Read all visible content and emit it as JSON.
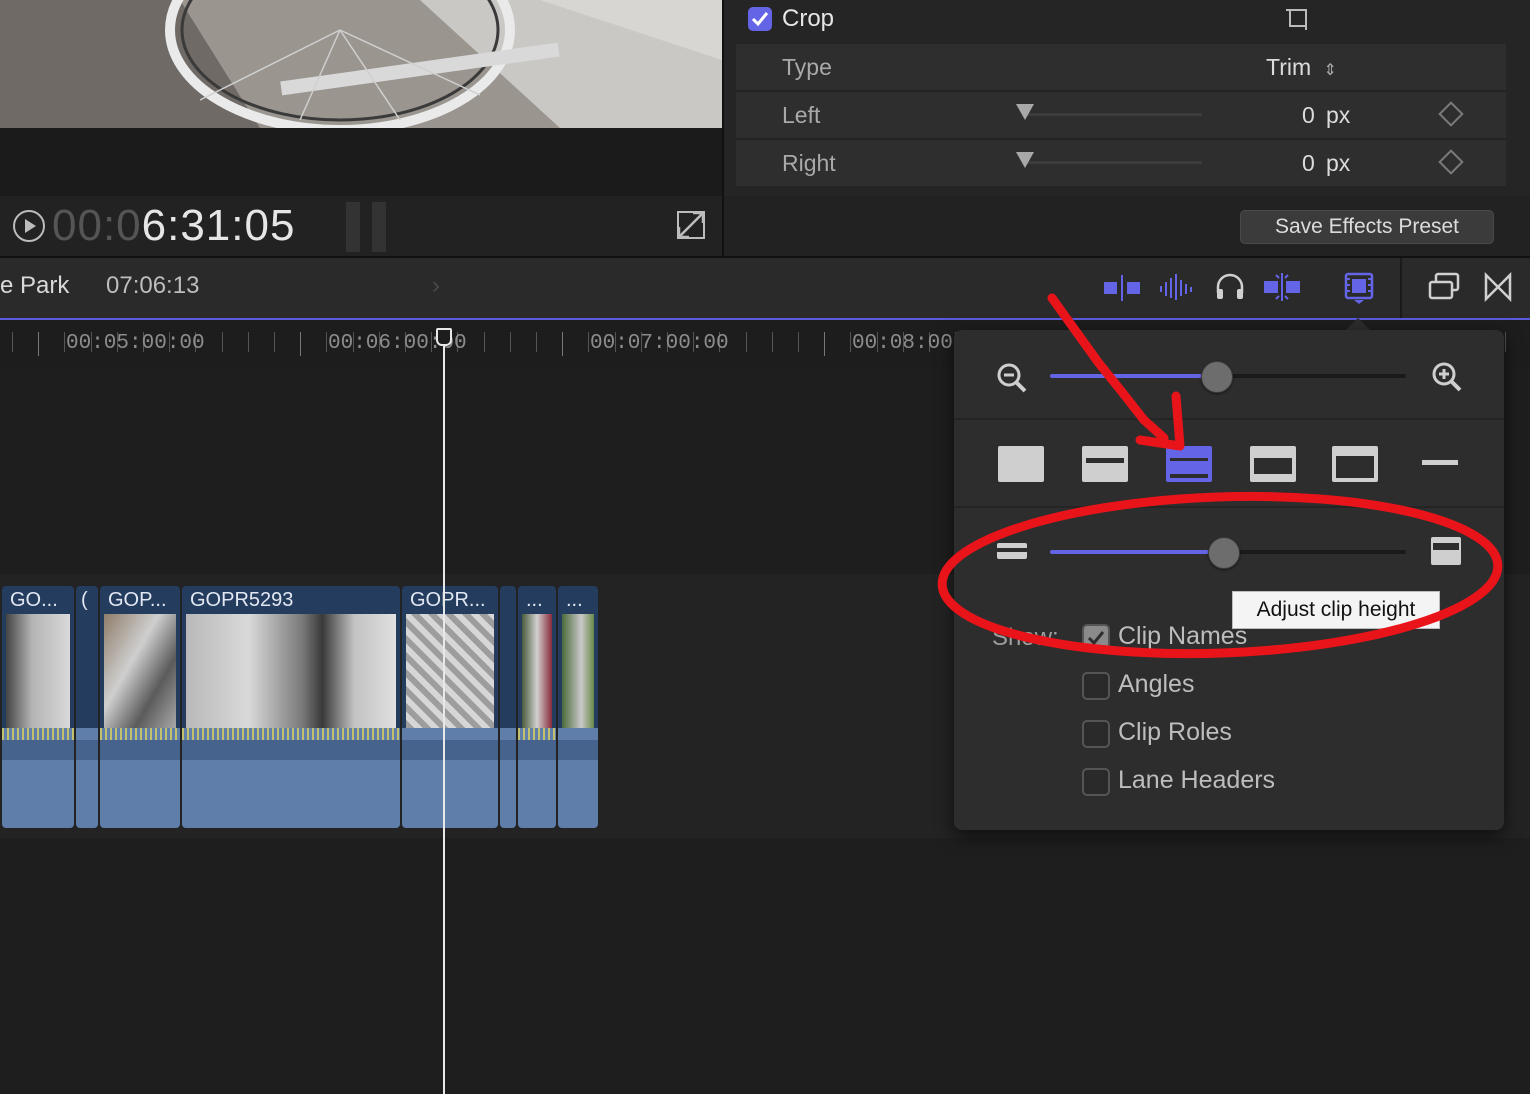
{
  "inspector": {
    "crop_label": "Crop",
    "type_label": "Type",
    "type_value": "Trim",
    "left_label": "Left",
    "left_value": "0",
    "left_unit": "px",
    "right_label": "Right",
    "right_value": "0",
    "right_unit": "px",
    "save_preset_label": "Save Effects Preset"
  },
  "viewer": {
    "timecode_dim": "00:0",
    "timecode_bright": "6:31:05"
  },
  "timeline_header": {
    "project_name": "e Park",
    "duration": "07:06:13"
  },
  "ruler": {
    "labels": [
      "00:05:00:00",
      "00:06:00:00",
      "00:07:00:00",
      "00:08:00:"
    ]
  },
  "clips": [
    {
      "title": "GO..."
    },
    {
      "title": "("
    },
    {
      "title": "GOP..."
    },
    {
      "title": "GOPR5293"
    },
    {
      "title": "GOPR..."
    },
    {
      "title": "..."
    },
    {
      "title": "..."
    }
  ],
  "popover": {
    "zoom_value": 0.47,
    "clip_height_value": 0.49,
    "show_label": "Show:",
    "options": [
      {
        "label": "Clip Names",
        "checked": true
      },
      {
        "label": "Angles",
        "checked": false
      },
      {
        "label": "Clip Roles",
        "checked": false
      },
      {
        "label": "Lane Headers",
        "checked": false
      }
    ],
    "tooltip": "Adjust clip height"
  },
  "colors": {
    "accent": "#6464e6",
    "annotation_red": "#e8141a",
    "clip_blue": "#5f7ea9"
  }
}
